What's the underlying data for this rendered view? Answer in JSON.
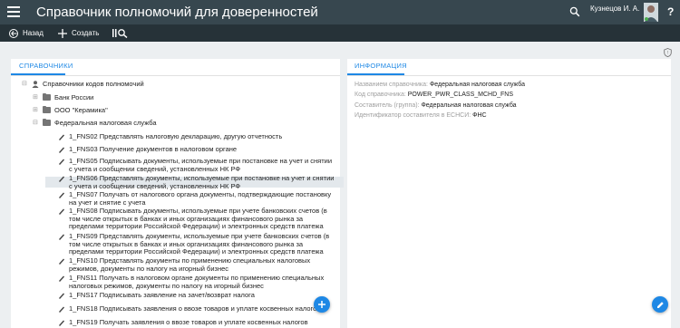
{
  "app": {
    "title": "Справочник полномочий для доверенностей"
  },
  "user": {
    "name": "Кузнецов И. А."
  },
  "header": {
    "help_label": "?"
  },
  "toolbar": {
    "back_label": "Назад",
    "create_label": "Создать"
  },
  "left_panel": {
    "tab_label": "Справочники"
  },
  "right_panel": {
    "tab_label": "Информация"
  },
  "tree": {
    "root": "Справочники кодов полномочий",
    "groups": [
      "Банк России",
      "ООО \"Керамика\"",
      "Федеральная налоговая служба"
    ],
    "items": [
      "1_FNS02 Представлять налоговую декларацию, другую отчетность",
      "1_FNS03 Получение документов в налоговом органе",
      "1_FNS05 Подписывать документы, используемые при постановке на учет и снятии с учета и сообщении сведений, установленных НК РФ",
      "1_FNS06 Представлять документы, используемые при постановке на учет и снятии с учета и сообщении сведений, установленных НК РФ",
      "1_FNS07 Получать от налогового органа документы, подтверждающие постановку на учет и снятие с учета",
      "1_FNS08 Подписывать документы, используемые при учете банковских счетов (в том числе открытых в банках и иных организациях финансового рынка за пределами территории Российской Федерации) и электронных средств платежа",
      "1_FNS09 Представлять документы, используемые при учете банковских счетов (в том числе открытых в банках и иных организациях финансового рынка за пределами территории Российской Федерации) и электронных средств платежа",
      "1_FNS10 Представлять документы по применению специальных налоговых режимов, документы по налогу на игорный бизнес",
      "1_FNS11 Получать в налоговом органе документы по применению специальных налоговых режимов, документы по налогу на игорный бизнес",
      "1_FNS17 Подписывать заявление на зачет/возврат налога",
      "1_FNS18 Подписывать заявления о ввозе товаров и уплате косвенных налогов",
      "1_FNS19 Получать заявления о ввозе товаров и уплате косвенных налогов"
    ]
  },
  "info": {
    "name_label": "Названием справочника:",
    "name_value": "Федеральная налоговая служба",
    "code_label": "Код справочника:",
    "code_value": "POWER_PWR_CLASS_MCHD_FNS",
    "owner_label": "Составитель (группа):",
    "owner_value": "Федеральная налоговая служба",
    "esnsi_label": "Идентификатор составителя в ЕСНСИ:",
    "esnsi_value": "ФНС"
  },
  "icons": {
    "menu": "hamburger-icon",
    "search": "search-icon",
    "avatar": "avatar-icon",
    "back": "arrow-left-icon",
    "create": "plus-icon",
    "search_list": "list-search-icon",
    "shield": "shield-icon",
    "folder": "folder-icon",
    "signature": "signature-pen-icon",
    "add": "plus-icon",
    "edit": "pencil-icon"
  },
  "colors": {
    "header": "#37474f",
    "toolbar": "#263238",
    "accent": "#1e88e5"
  }
}
